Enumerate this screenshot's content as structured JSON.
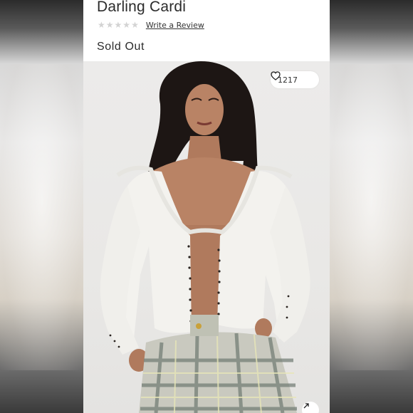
{
  "product": {
    "title": "Darling Cardi",
    "rating": {
      "stars_filled": 0,
      "stars_total": 5,
      "review_link": "Write a Review"
    },
    "status": "Sold Out"
  },
  "image": {
    "favorites_count": "1217",
    "icons": {
      "favorite": "heart-outline-icon",
      "expand": "arrow-up-right-icon",
      "rating_star": "star-icon"
    }
  },
  "colors": {
    "text": "#2b2b2b",
    "star_empty": "#d3d3d3",
    "photo_bg": "#ebeae8"
  }
}
